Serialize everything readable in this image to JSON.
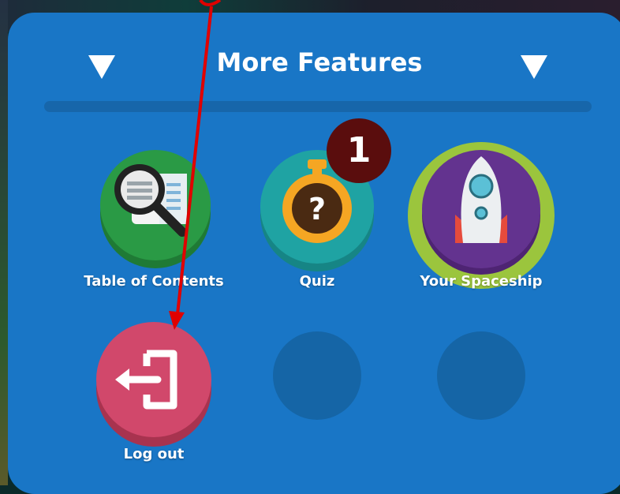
{
  "header": {
    "title": "More Features"
  },
  "features": [
    {
      "label": "Table of Contents",
      "icon": "table-of-contents-icon"
    },
    {
      "label": "Quiz",
      "icon": "quiz-stopwatch-icon",
      "badge": "1"
    },
    {
      "label": "Your Spaceship",
      "icon": "spaceship-icon"
    },
    {
      "label": "Log out",
      "icon": "logout-icon"
    }
  ],
  "colors": {
    "panel": "#1976c6",
    "divider": "#1766aa",
    "toc_green": "#2a9a45",
    "quiz_teal": "#1fa3a3",
    "spaceship_purple": "#63338f",
    "spaceship_ring": "#9bc53d",
    "logout_pink": "#d1486b",
    "badge": "#5a0d0d",
    "annotation_arrow": "#e00000"
  }
}
